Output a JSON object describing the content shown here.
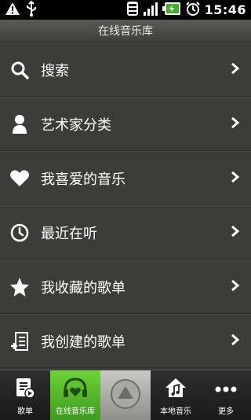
{
  "status_bar": {
    "time": "15:46",
    "icons": [
      "warning-icon",
      "usb-icon",
      "wifi-icon",
      "signal-icon",
      "battery-icon",
      "alarm-icon"
    ]
  },
  "header": {
    "title": "在线音乐库"
  },
  "menu": {
    "items": [
      {
        "label": "搜索",
        "icon": "search-icon"
      },
      {
        "label": "艺术家分类",
        "icon": "person-icon"
      },
      {
        "label": "我喜爱的音乐",
        "icon": "heart-icon"
      },
      {
        "label": "最近在听",
        "icon": "clock-icon"
      },
      {
        "label": "我收藏的歌单",
        "icon": "star-icon"
      },
      {
        "label": "我创建的歌单",
        "icon": "add-playlist-icon"
      }
    ]
  },
  "tabbar": {
    "tabs": [
      {
        "label": "歌单",
        "icon": "playlist-icon"
      },
      {
        "label": "在线音乐库",
        "icon": "headphones-heart-icon",
        "active": true
      },
      {
        "label": "",
        "icon": "up-arrow-icon"
      },
      {
        "label": "本地音乐",
        "icon": "home-music-icon"
      },
      {
        "label": "更多",
        "icon": "more-dots-icon"
      }
    ]
  },
  "colors": {
    "accent": "#5cbf2a",
    "background": "#3c3d39",
    "status_bar": "#000000"
  }
}
